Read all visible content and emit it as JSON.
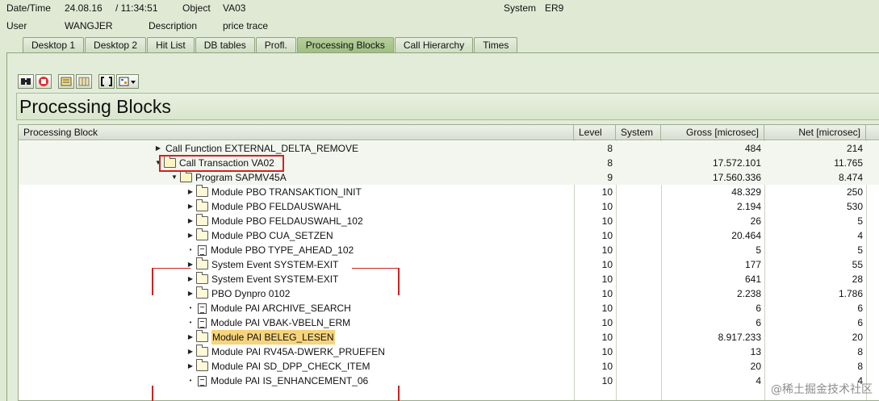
{
  "header": {
    "date_time_label": "Date/Time",
    "date": "24.08.16",
    "time": "/ 11:34:51",
    "object_label": "Object",
    "object_value": "VA03",
    "system_label": "System",
    "system_value": "ER9",
    "user_label": "User",
    "user_value": "WANGJER",
    "description_label": "Description",
    "description_value": "price trace"
  },
  "tabs": [
    {
      "label": "Desktop 1"
    },
    {
      "label": "Desktop 2"
    },
    {
      "label": "Hit List"
    },
    {
      "label": "DB tables"
    },
    {
      "label": "Profl."
    },
    {
      "label": "Processing Blocks"
    },
    {
      "label": "Call Hierarchy"
    },
    {
      "label": "Times"
    }
  ],
  "active_tab": "Processing Blocks",
  "toolbar": [
    "find-icon",
    "stop-icon",
    "expand-icon",
    "collapse-icon",
    "brackets-icon",
    "layout-menu-icon"
  ],
  "title": "Processing Blocks",
  "columns": {
    "block": "Processing Block",
    "level": "Level",
    "system": "System",
    "gross": "Gross [microsec]",
    "net": "Net [microsec]"
  },
  "rows": [
    {
      "label": "Call Function EXTERNAL_DELTA_REMOVE",
      "level": "8",
      "gross": "484",
      "net": "214"
    },
    {
      "label": "Call Transaction VA02",
      "level": "8",
      "gross": "17.572.101",
      "net": "11.765"
    },
    {
      "label": "Program SAPMV45A",
      "level": "9",
      "gross": "17.560.336",
      "net": "8.474"
    },
    {
      "label": "Module PBO TRANSAKTION_INIT",
      "level": "10",
      "gross": "48.329",
      "net": "250"
    },
    {
      "label": "Module PBO FELDAUSWAHL",
      "level": "10",
      "gross": "2.194",
      "net": "530"
    },
    {
      "label": "Module PBO FELDAUSWAHL_102",
      "level": "10",
      "gross": "26",
      "net": "5"
    },
    {
      "label": "Module PBO CUA_SETZEN",
      "level": "10",
      "gross": "20.464",
      "net": "4"
    },
    {
      "label": "Module PBO TYPE_AHEAD_102",
      "level": "10",
      "gross": "5",
      "net": "5"
    },
    {
      "label": "System Event SYSTEM-EXIT",
      "level": "10",
      "gross": "177",
      "net": "55"
    },
    {
      "label": "System Event SYSTEM-EXIT",
      "level": "10",
      "gross": "641",
      "net": "28"
    },
    {
      "label": "PBO Dynpro 0102",
      "level": "10",
      "gross": "2.238",
      "net": "1.786"
    },
    {
      "label": "Module PAI ARCHIVE_SEARCH",
      "level": "10",
      "gross": "6",
      "net": "6"
    },
    {
      "label": "Module PAI VBAK-VBELN_ERM",
      "level": "10",
      "gross": "6",
      "net": "6"
    },
    {
      "label": "Module PAI BELEG_LESEN",
      "level": "10",
      "gross": "8.917.233",
      "net": "20"
    },
    {
      "label": "Module PAI RV45A-DWERK_PRUEFEN",
      "level": "10",
      "gross": "13",
      "net": "8"
    },
    {
      "label": "Module PAI SD_DPP_CHECK_ITEM",
      "level": "10",
      "gross": "20",
      "net": "8"
    },
    {
      "label": "Module PAI IS_ENHANCEMENT_06",
      "level": "10",
      "gross": "4",
      "net": "4"
    }
  ],
  "watermark": "@稀土掘金技术社区",
  "colors": {
    "highlight_box": "#d42020",
    "selected_row": "#f7d47b",
    "background": "#dfe9d4"
  }
}
